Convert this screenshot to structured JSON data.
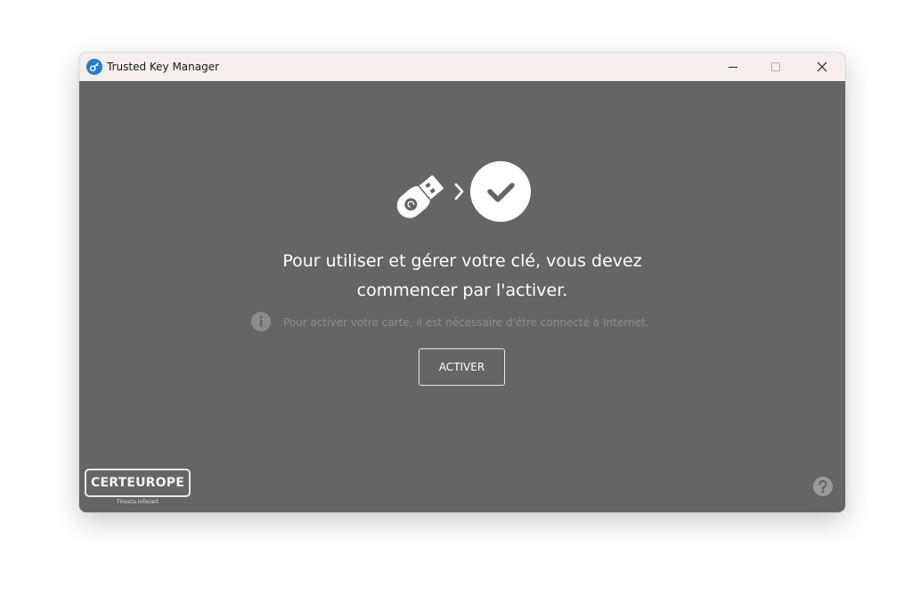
{
  "window": {
    "title": "Trusted Key Manager"
  },
  "main": {
    "headline_line1": "Pour utiliser et gérer votre clé, vous devez",
    "headline_line2": "commencer par l'activer.",
    "info_text": "Pour activer votre carte, il est nécessaire d'être connecté à Internet.",
    "activate_label": "ACTIVER"
  },
  "footer": {
    "logo_text": "CERTEUROPE",
    "logo_subtext": "Tinexta Infocert"
  },
  "icons": {
    "app": "key-app-icon",
    "hero_key": "usb-key-icon",
    "hero_arrow": "chevron-right-icon",
    "hero_check": "check-circle-icon",
    "info": "info-icon",
    "help": "help-icon"
  },
  "colors": {
    "content_bg": "#656565",
    "titlebar_bg": "#f6eeec",
    "accent_blue": "#1a7fd6",
    "text_primary": "#ffffff",
    "text_muted": "#8c8c8c"
  }
}
